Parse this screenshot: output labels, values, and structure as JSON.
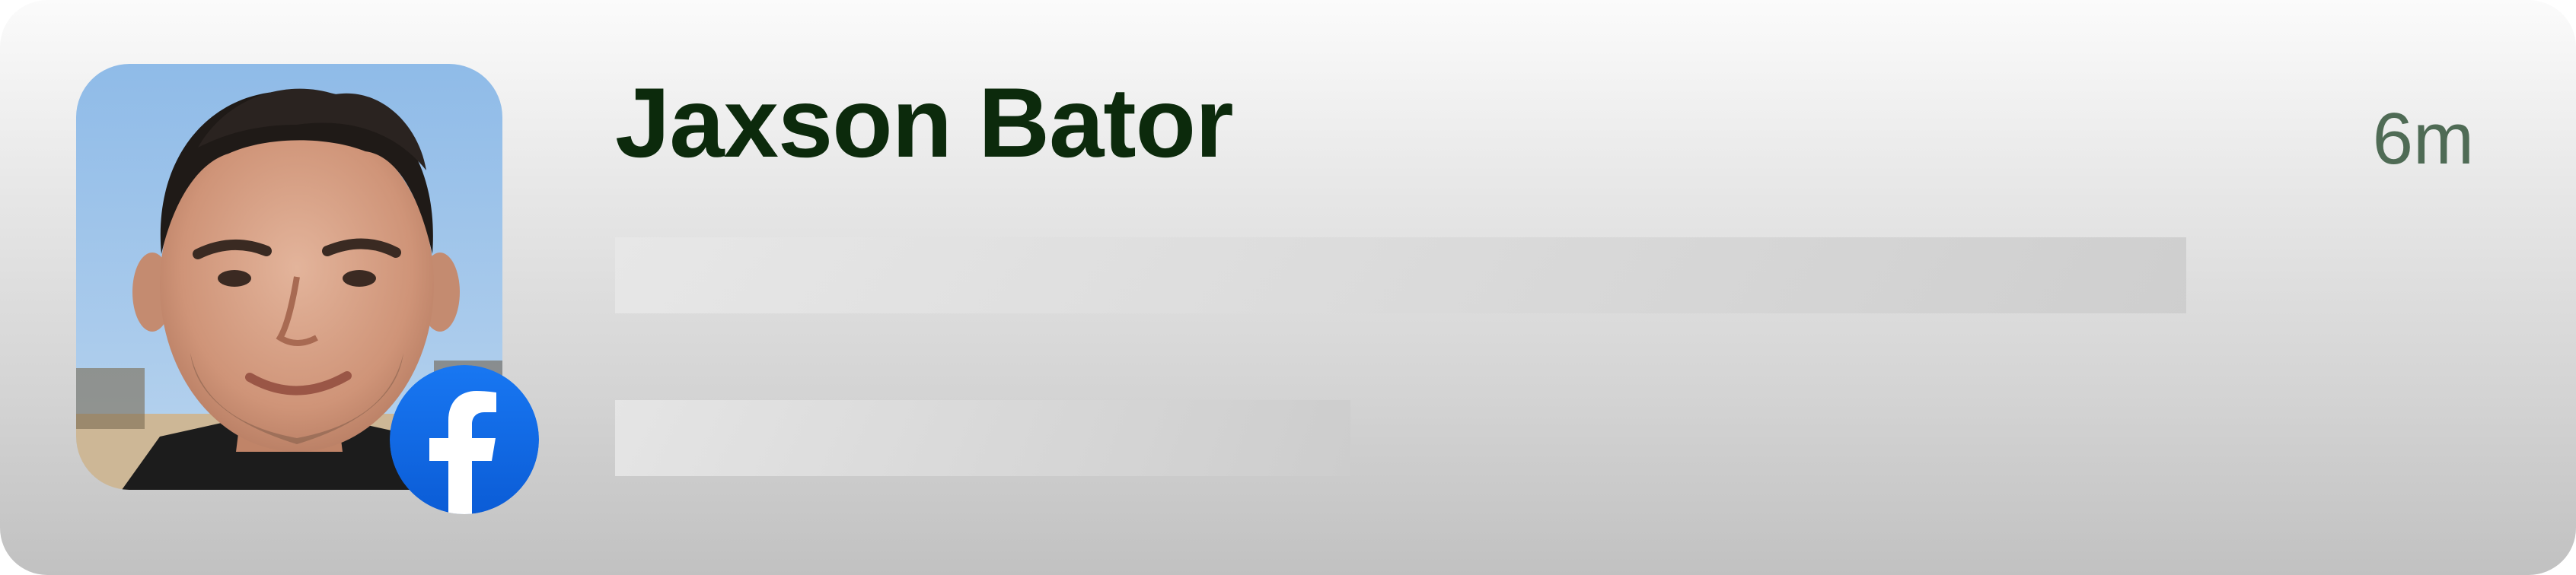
{
  "notification": {
    "sender_name": "Jaxson Bator",
    "time_ago": "6m",
    "badge_icon": "facebook-icon",
    "avatar_icon": "person-photo-icon"
  },
  "colors": {
    "name": "#0c2a0c",
    "time": "#4f6b55",
    "facebook_blue": "#1877f2",
    "facebook_blue_dark": "#0b5cd6"
  }
}
